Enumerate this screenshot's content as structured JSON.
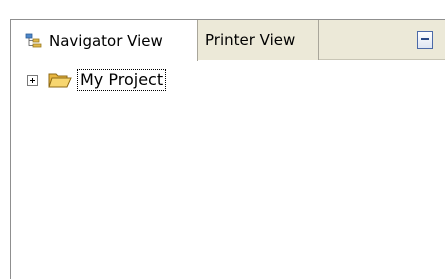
{
  "tabs": [
    {
      "label": "Navigator View",
      "icon": "navigator-tree-icon",
      "active": true
    },
    {
      "label": "Printer View",
      "active": false
    }
  ],
  "toolbar": {
    "minimize_icon": "minimize-icon"
  },
  "tree": {
    "items": [
      {
        "label": "My Project",
        "icon": "open-folder-icon",
        "expander": "plus-expander-icon",
        "selected": true
      }
    ]
  },
  "colors": {
    "tabbar_bg": "#ece9d8",
    "folder": "#f5c94a",
    "accent": "#4c6aa8"
  }
}
